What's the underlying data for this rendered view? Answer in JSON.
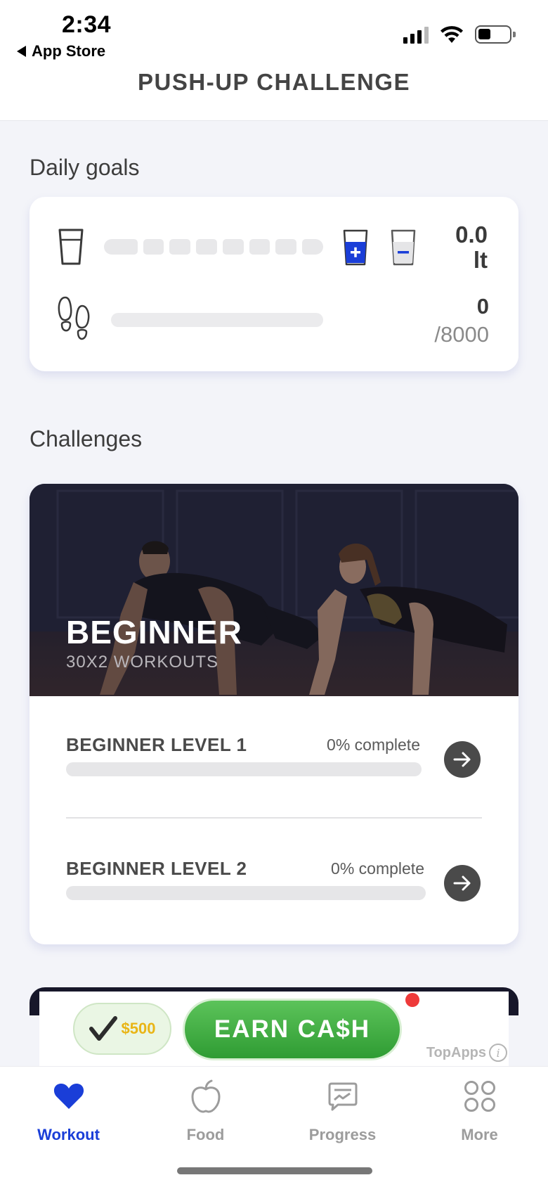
{
  "status_bar": {
    "time": "2:34",
    "back_label": "App Store"
  },
  "header": {
    "title": "PUSH-UP CHALLENGE"
  },
  "daily_goals": {
    "section_title": "Daily goals",
    "water": {
      "value": "0.0",
      "unit": "lt",
      "progress": 0,
      "segments": 8
    },
    "steps": {
      "value": "0",
      "goal": "/8000",
      "progress": 0
    }
  },
  "challenges": {
    "section_title": "Challenges",
    "card": {
      "title": "BEGINNER",
      "subtitle": "30X2 WORKOUTS",
      "levels": [
        {
          "name": "BEGINNER LEVEL 1",
          "progress_label": "0% complete",
          "progress": 0
        },
        {
          "name": "BEGINNER LEVEL 2",
          "progress_label": "0% complete",
          "progress": 0
        }
      ]
    }
  },
  "ad": {
    "reward": "$500",
    "cta": "EARN CA$H",
    "brand": "TopApps",
    "info": "i"
  },
  "tabbar": {
    "tabs": [
      {
        "label": "Workout",
        "icon": "heart-icon",
        "active": true
      },
      {
        "label": "Food",
        "icon": "apple-icon",
        "active": false
      },
      {
        "label": "Progress",
        "icon": "progress-chart-icon",
        "active": false
      },
      {
        "label": "More",
        "icon": "grid-icon",
        "active": false
      }
    ]
  },
  "colors": {
    "accent": "#1a3ed8",
    "inactive": "#9c9c9c",
    "cta_green": "#2f9c33",
    "background": "#f3f4f9"
  }
}
